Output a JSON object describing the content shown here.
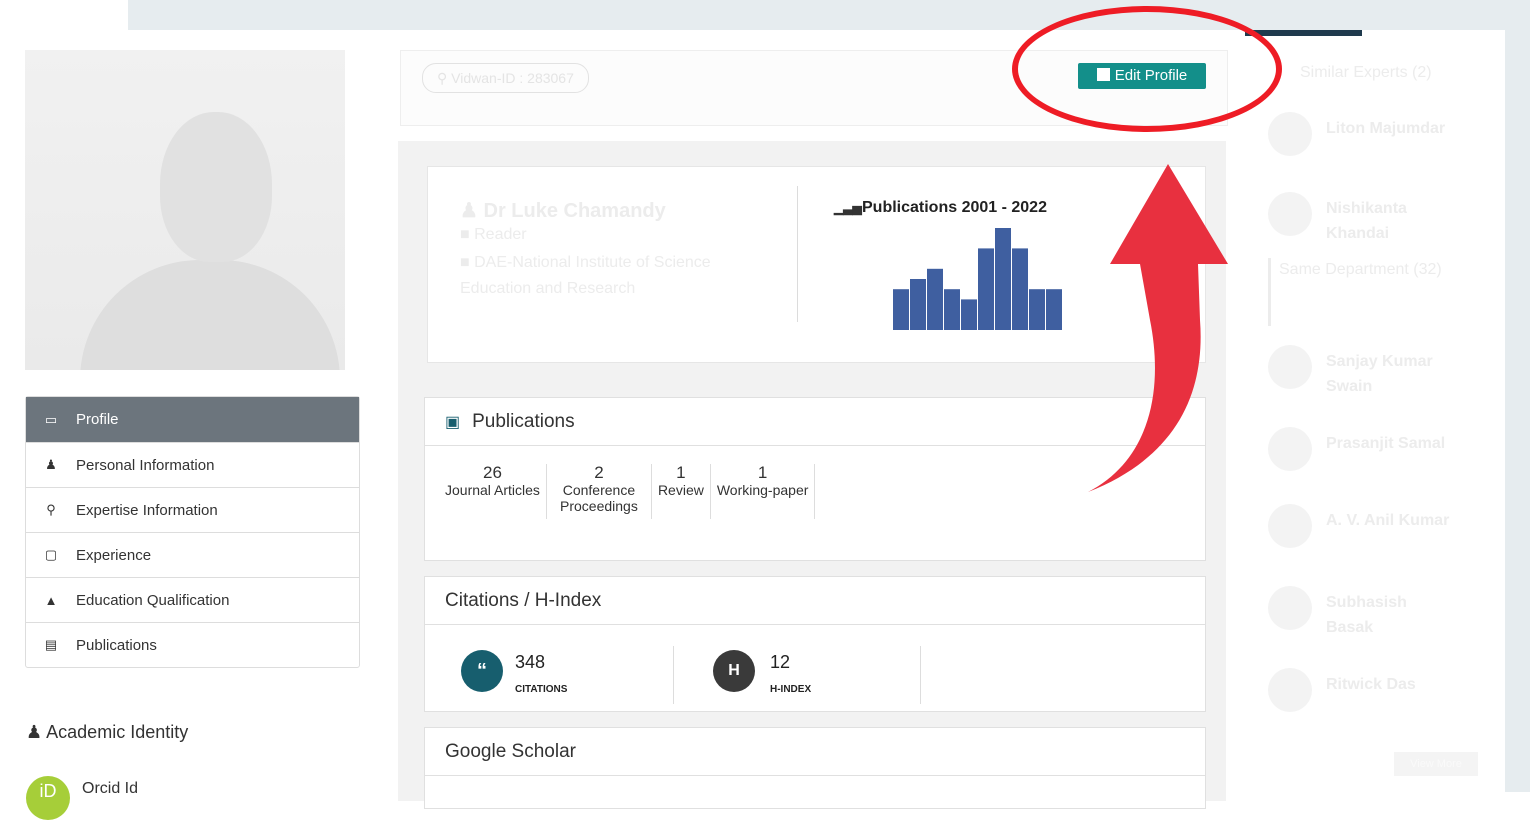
{
  "header": {
    "vidwan_id": "Vidwan-ID : 283067",
    "edit_profile": "Edit Profile"
  },
  "profile": {
    "name": "Dr Luke Chamandy",
    "designation": "Reader",
    "institution": "DAE-National Institute of Science Education and Research"
  },
  "sidebar": {
    "items": [
      {
        "label": "Profile",
        "icon": "monitor-icon",
        "active": true
      },
      {
        "label": "Personal Information",
        "icon": "user-icon"
      },
      {
        "label": "Expertise Information",
        "icon": "lightbulb-icon"
      },
      {
        "label": "Experience",
        "icon": "briefcase-icon"
      },
      {
        "label": "Education Qualification",
        "icon": "graduation-cap-icon"
      },
      {
        "label": "Publications",
        "icon": "books-icon"
      }
    ]
  },
  "academic": {
    "title": "Academic Identity",
    "orcid_label": "Orcid Id",
    "orcid_badge": "iD"
  },
  "publications_chart": {
    "title": "Publications 2001 - 2022",
    "icon": "bar-chart-icon",
    "color": "#3f5fa0",
    "values": [
      4,
      5,
      6,
      4,
      3,
      8,
      10,
      8,
      4,
      4
    ]
  },
  "publications": {
    "title": "Publications",
    "counts": [
      {
        "num": "26",
        "label": "Journal Articles"
      },
      {
        "num": "2",
        "label": "Conference Proceedings"
      },
      {
        "num": "1",
        "label": "Review"
      },
      {
        "num": "1",
        "label": "Working-paper"
      }
    ]
  },
  "citations": {
    "title": "Citations / H-Index",
    "citations_value": "348",
    "citations_label": "CITATIONS",
    "citations_icon": "quote-icon",
    "hindex_value": "12",
    "hindex_label": "H-INDEX",
    "hindex_badge": "H",
    "colors": {
      "citations": "#175e6e",
      "hindex": "#3a3a3a"
    }
  },
  "google_scholar": {
    "title": "Google Scholar"
  },
  "similar_experts": {
    "title": "Similar Experts (2)",
    "experts": [
      "Liton Majumdar",
      "Nishikanta Khandai"
    ],
    "same_department": "Same Department (32)",
    "dept_experts": [
      "Sanjay Kumar Swain",
      "Prasanjit Samal",
      "A. V. Anil Kumar",
      "Subhasish Basak",
      "Ritwick Das"
    ],
    "view_more": "View More"
  },
  "annotation": {
    "color": "#ee1c25",
    "arrow_color": "#e8303f"
  }
}
